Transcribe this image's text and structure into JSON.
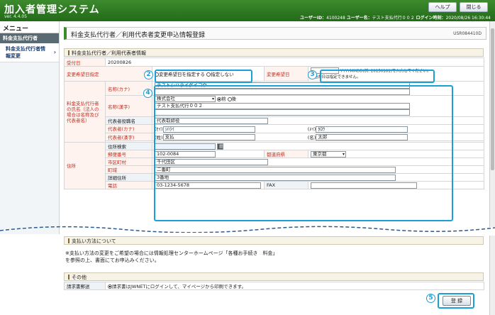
{
  "header": {
    "app_title": "加入者管理システム",
    "version": "ver. 4.4.05",
    "help_label": "ヘルプ",
    "close_label": "閉じる",
    "user_id_label": "ユーザーID：",
    "user_id": "4100248",
    "user_name_label": "ユーザー名：",
    "user_name": "テスト支払代行００２",
    "login_label": "ログイン時刻：",
    "login_time": "2020/08/26 16:30:44"
  },
  "sidebar": {
    "menu_title": "メニュー",
    "category": "料金支払代行者",
    "items": [
      {
        "label": "料金支払代行者情報変更"
      }
    ]
  },
  "page": {
    "title": "料金支払代行者／利用代表者変更申込情報登録",
    "screen_id": "USR084410D"
  },
  "section1": {
    "title": "料金支払代行者／利用代表者情報",
    "received_label": "受付日",
    "received_value": "20200826",
    "change_date_spec_label": "変更希望日指定",
    "radio_specify": "変更希望日を指定する",
    "radio_not_specify": "指定しない",
    "change_date_label": "変更希望日",
    "change_date_hint": "YYYYMMDD(例: 20150101)で入力してください。",
    "change_date_hint2": "※過去日は指定できません。",
    "agent_name_group_label": "料金支払代行者の氏名（法人の場合は名称及び代表者名）",
    "name_kana_label": "名称(カナ)",
    "name_kana_value": "テストシハライダイコウ",
    "name_kanji_label": "名称(漢字)",
    "corp_type_value": "株式会社",
    "radio_front": "前",
    "radio_back": "後",
    "name_kanji_value": "テスト支払代行００２",
    "rep_title_label": "代表者役職名",
    "rep_title_value": "代表取締役",
    "rep_kana_label": "代表者(カナ)",
    "sei_kana_prefix": "(ｾｲ)",
    "sei_kana_value": "ｼﾊﾗｲ",
    "mei_kana_prefix": "(ﾒｲ)",
    "mei_kana_value": "ﾀﾛｳ",
    "rep_kanji_label": "代表者(漢字)",
    "sei_prefix": "(姓)",
    "sei_value": "支払",
    "mei_prefix": "(名)",
    "mei_value": "太郎",
    "address_group_label": "住所",
    "addr_search_label": "住所検索",
    "postal_label": "郵便番号",
    "postal_value": "102-0084",
    "pref_label": "都道府県",
    "pref_value": "東京都",
    "city_label": "市区町村",
    "city_value": "千代田区",
    "town_label": "町域",
    "town_value": "二番町",
    "detail_label": "詳細住所",
    "detail_value": "3番地",
    "tel_label": "電話",
    "tel_value": "03-1234-5678",
    "fax_label": "FAX",
    "fax_value": ""
  },
  "section2": {
    "title": "支払い方法について",
    "note_line1": "※支払い方法の変更をご希望の場合には情報処理センターホームページ「各種お手続き　料金」",
    "note_line2": "を参照の上、書面にてお申込みください。"
  },
  "section3": {
    "title": "その他",
    "invoice_label": "請求書郵送",
    "invoice_option": "請求書はJWNETにログインして、マイページから印刷できます。"
  },
  "register_label": "登 録",
  "markers": {
    "m2": "2",
    "m3": "3",
    "m4": "4",
    "m5": "5"
  },
  "colors": {
    "header_green": "#2e7a22",
    "highlight_blue": "#1aa0d8",
    "required_red": "#c03020"
  }
}
